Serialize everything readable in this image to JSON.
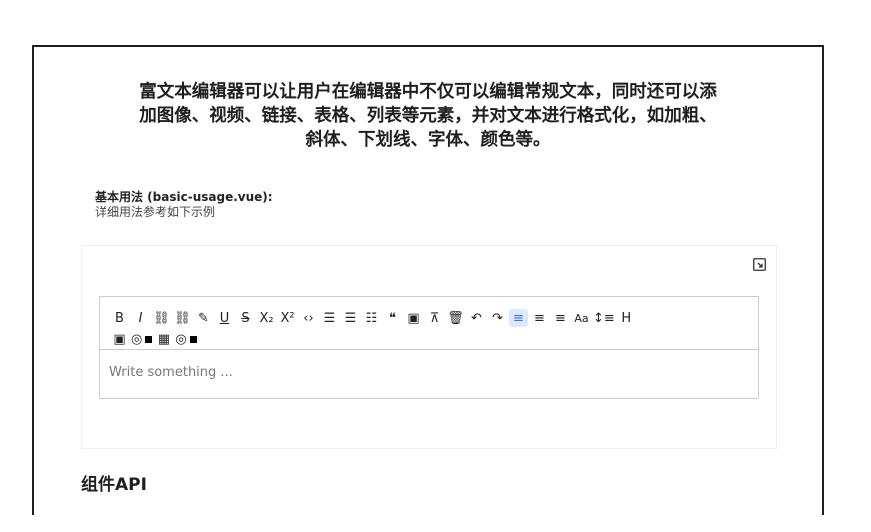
{
  "intro": {
    "line1": "富文本编辑器可以让用户在编辑器中不仅可以编辑常规文本，同时还可以添",
    "line2": "加图像、视频、链接、表格、列表等元素，并对文本进行格式化，如加粗、",
    "line3": "斜体、下划线、字体、颜色等。"
  },
  "section": {
    "title": "基本用法 (basic-usage.vue):",
    "desc": "详细用法参考如下示例"
  },
  "editor": {
    "placeholder": "Write something ...",
    "toolbar_row1": [
      {
        "name": "bold-button",
        "label": "B"
      },
      {
        "name": "italic-button",
        "label": "I"
      },
      {
        "name": "link-button",
        "label": "⛓"
      },
      {
        "name": "unlink-button",
        "label": "⛓"
      },
      {
        "name": "highlight-button",
        "label": "✎"
      },
      {
        "name": "underline-button",
        "label": "U"
      },
      {
        "name": "strikethrough-button",
        "label": "S"
      },
      {
        "name": "subscript-button",
        "label": "X₂"
      },
      {
        "name": "superscript-button",
        "label": "X²"
      },
      {
        "name": "code-button",
        "label": "‹›"
      },
      {
        "name": "bullet-list-button",
        "label": "☰"
      },
      {
        "name": "ordered-list-button",
        "label": "☰"
      },
      {
        "name": "task-list-button",
        "label": "☷"
      },
      {
        "name": "blockquote-button",
        "label": "❝"
      },
      {
        "name": "code-block-button",
        "label": "▣"
      },
      {
        "name": "clear-format-button",
        "label": "⊼"
      },
      {
        "name": "delete-button",
        "label": "🗑"
      },
      {
        "name": "undo-button",
        "label": "↶"
      },
      {
        "name": "redo-button",
        "label": "↷"
      },
      {
        "name": "align-left-button",
        "label": "≡",
        "active": true
      },
      {
        "name": "align-center-button",
        "label": "≡"
      },
      {
        "name": "align-right-button",
        "label": "≡"
      },
      {
        "name": "font-size-button",
        "label": "Aa"
      },
      {
        "name": "line-height-button",
        "label": "↕≡"
      },
      {
        "name": "heading-button",
        "label": "H"
      }
    ],
    "toolbar_row2": [
      {
        "name": "image-button",
        "label": "▣"
      },
      {
        "name": "text-color-button",
        "label": "◎",
        "swatch": "#000000"
      },
      {
        "name": "table-button",
        "label": "▦"
      },
      {
        "name": "background-color-button",
        "label": "◎",
        "swatch": "#000000"
      }
    ]
  },
  "api": {
    "title": "组件API"
  }
}
